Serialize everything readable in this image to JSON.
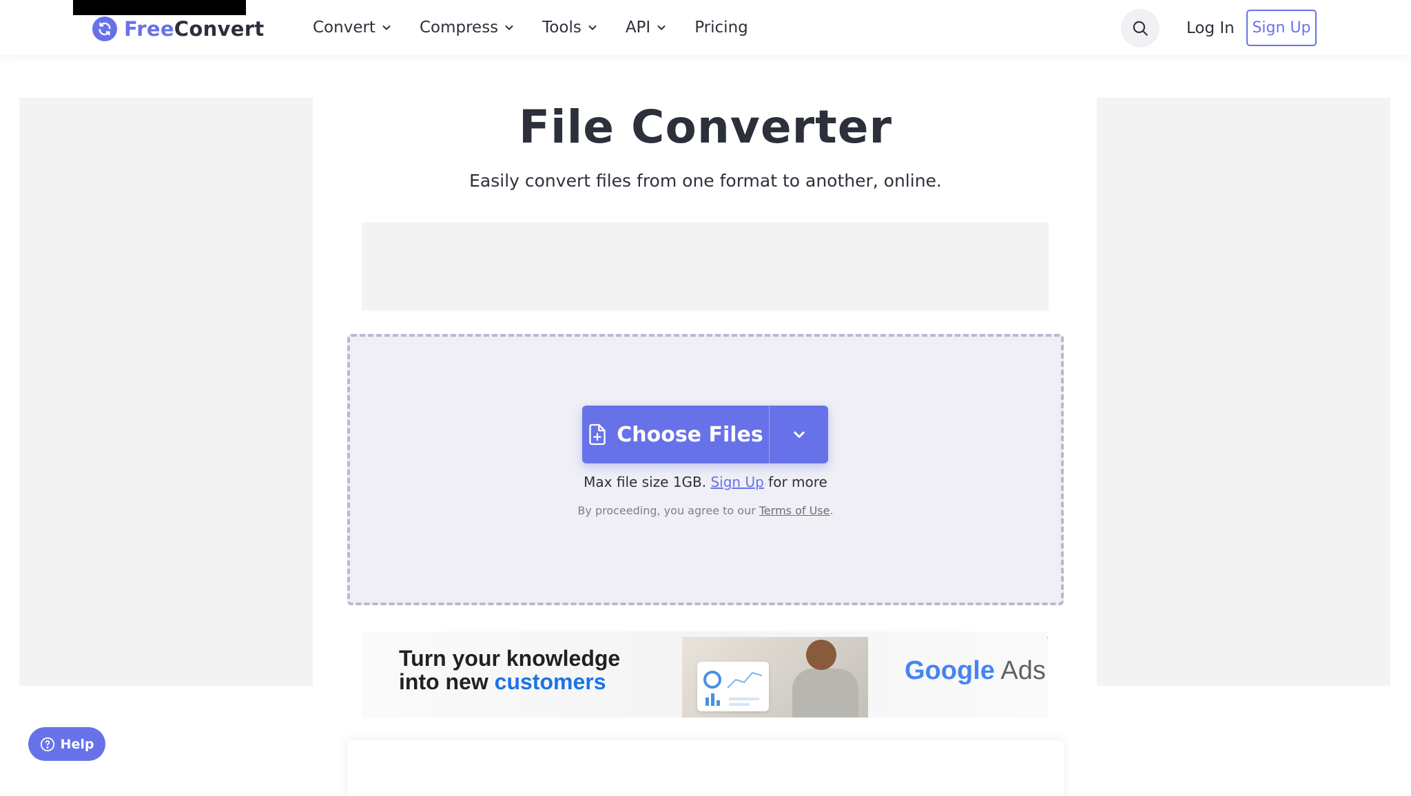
{
  "colors": {
    "brand": "#6872e8",
    "text": "#2b303a",
    "dropzone_bg": "#efeff5",
    "dropzone_border": "#b9b8d3"
  },
  "header": {
    "logo": {
      "part1": "Free",
      "part2": "Convert",
      "icon": "refresh-icon"
    },
    "nav": [
      {
        "label": "Convert",
        "icon": "chevron-down-icon"
      },
      {
        "label": "Compress",
        "icon": "chevron-down-icon"
      },
      {
        "label": "Tools",
        "icon": "chevron-down-icon"
      },
      {
        "label": "API",
        "icon": "chevron-down-icon"
      },
      {
        "label": "Pricing"
      }
    ],
    "search_icon": "search-icon",
    "login_label": "Log In",
    "signup_label": "Sign Up"
  },
  "main": {
    "title": "File Converter",
    "subtitle": "Easily convert files from one format to another, online.",
    "choose_files_label": "Choose Files",
    "choose_icon": "file-plus-icon",
    "dropdown_icon": "chevron-down-icon",
    "max_size_prefix": "Max file size 1GB.",
    "max_size_link": "Sign Up",
    "max_size_suffix": "for more",
    "terms_prefix": "By proceeding, you agree to our",
    "terms_link": "Terms of Use",
    "terms_suffix": "."
  },
  "ad": {
    "line1": "Turn your knowledge",
    "line2_plain": "into new",
    "line2_accent": "customers",
    "brand_google": "Google",
    "brand_ads": "Ads"
  },
  "help": {
    "label": "Help",
    "icon": "question-circle-icon"
  }
}
